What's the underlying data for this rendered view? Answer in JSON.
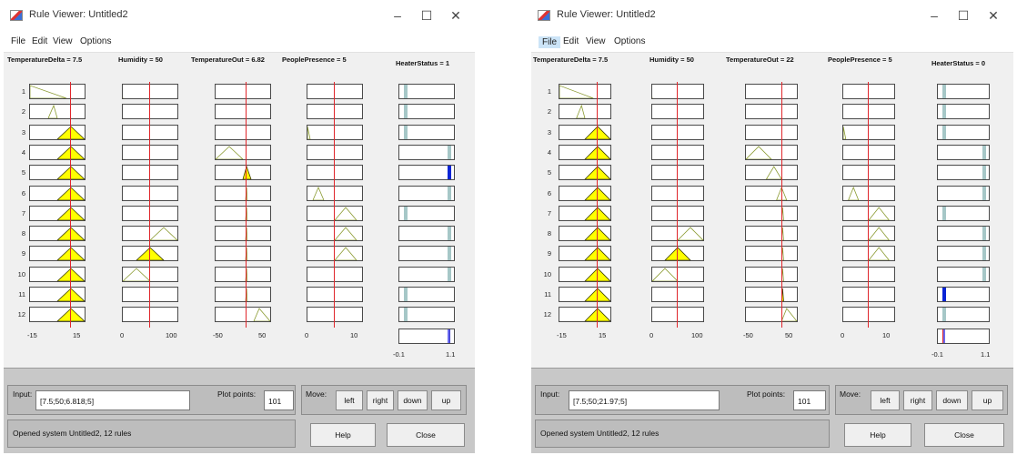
{
  "windows": [
    {
      "id": "w1",
      "title": "Rule Viewer: Untitled2",
      "controls": {
        "minimize": "–",
        "maximize": "☐",
        "close": "✕"
      },
      "menu": [
        "File",
        "Edit",
        "View",
        "Options"
      ],
      "active_menu": -1,
      "inputs": [
        {
          "header": "TemperatureDelta = 7.5",
          "range": [
            -15,
            15
          ],
          "value": 7.5,
          "ticks": [
            "-15",
            "15"
          ]
        },
        {
          "header": "Humidity = 50",
          "range": [
            0,
            100
          ],
          "value": 50,
          "ticks": [
            "0",
            "100"
          ]
        },
        {
          "header": "TemperatureOut = 6.82",
          "range": [
            -50,
            50
          ],
          "value": 6.82,
          "ticks": [
            "-50",
            "50"
          ]
        },
        {
          "header": "PeoplePresence = 5",
          "range": [
            0,
            10
          ],
          "value": 5,
          "ticks": [
            "0",
            "10"
          ]
        }
      ],
      "output": {
        "header": "HeaterStatus = 1",
        "range": [
          -0.1,
          1.1
        ],
        "value": 1,
        "ticks": [
          "-0.1",
          "1.1"
        ]
      },
      "rule_numbers": [
        "1",
        "2",
        "3",
        "4",
        "5",
        "6",
        "7",
        "8",
        "9",
        "10",
        "11",
        "12"
      ],
      "rules": [
        {
          "mf": [
            [
              -15,
              -15,
              5
            ],
            [
              -5,
              -5,
              0
            ],
            null,
            null
          ],
          "fire": [
            0,
            0,
            0,
            0
          ],
          "out": [
            0.0,
            0.04,
            0.0
          ]
        },
        {
          "mf": [
            [
              -5,
              -2,
              0
            ],
            null,
            null,
            null
          ],
          "fire": [
            0,
            0,
            0,
            0
          ],
          "out": [
            0.0,
            0.04,
            0.0
          ]
        },
        {
          "mf": [
            [
              0,
              7.5,
              15
            ],
            null,
            null,
            [
              0,
              0,
              0.5
            ]
          ],
          "fire": [
            1,
            0,
            0,
            0
          ],
          "out": [
            0.0,
            0.04,
            0.0
          ]
        },
        {
          "mf": [
            [
              0,
              7.5,
              15
            ],
            null,
            [
              -50,
              -25,
              0
            ],
            null
          ],
          "fire": [
            1,
            0,
            0,
            0
          ],
          "out": [
            0.96,
            1.0,
            0.0
          ]
        },
        {
          "mf": [
            [
              0,
              7.5,
              15
            ],
            null,
            [
              0,
              6.8,
              15
            ],
            null
          ],
          "fire": [
            1,
            0,
            1,
            0
          ],
          "out": [
            0.96,
            1.0,
            1.0
          ]
        },
        {
          "mf": [
            [
              0,
              7.5,
              15
            ],
            null,
            [
              5,
              6.8,
              8
            ],
            [
              1,
              2,
              3
            ]
          ],
          "fire": [
            1,
            0,
            0,
            0
          ],
          "out": [
            0.96,
            1.0,
            0.0
          ]
        },
        {
          "mf": [
            [
              0,
              7.5,
              15
            ],
            null,
            [
              5,
              6.8,
              8
            ],
            [
              5,
              7,
              9
            ]
          ],
          "fire": [
            1,
            0,
            0,
            0
          ],
          "out": [
            0.0,
            0.04,
            0.0
          ]
        },
        {
          "mf": [
            [
              0,
              7.5,
              15
            ],
            [
              50,
              75,
              100
            ],
            [
              5,
              6.8,
              8
            ],
            [
              5,
              7,
              9
            ]
          ],
          "fire": [
            1,
            0,
            0,
            0
          ],
          "out": [
            0.96,
            1.0,
            0.0
          ]
        },
        {
          "mf": [
            [
              0,
              7.5,
              15
            ],
            [
              25,
              50,
              75
            ],
            [
              5,
              6.8,
              8
            ],
            [
              5,
              7,
              9
            ]
          ],
          "fire": [
            1,
            1,
            0,
            0
          ],
          "out": [
            0.96,
            1.0,
            0.0
          ]
        },
        {
          "mf": [
            [
              0,
              7.5,
              15
            ],
            [
              0,
              25,
              50
            ],
            [
              5,
              6.8,
              8
            ],
            null
          ],
          "fire": [
            1,
            0,
            0,
            0
          ],
          "out": [
            0.96,
            1.0,
            0.0
          ]
        },
        {
          "mf": [
            [
              0,
              7.5,
              15
            ],
            null,
            [
              5,
              6.8,
              8
            ],
            null
          ],
          "fire": [
            1,
            0,
            0,
            0
          ],
          "out": [
            0.0,
            0.04,
            0.0
          ]
        },
        {
          "mf": [
            [
              0,
              7.5,
              15
            ],
            null,
            [
              20,
              30,
              50
            ],
            null
          ],
          "fire": [
            1,
            0,
            0,
            0
          ],
          "out": [
            0.0,
            0.04,
            0.0
          ]
        }
      ],
      "aggregate_bar": [
        0.96,
        1.0
      ],
      "bottom": {
        "input_label": "Input:",
        "input_value": "[7.5;50;6.818;5]",
        "plot_points_label": "Plot points:",
        "plot_points_value": "101",
        "move_label": "Move:",
        "move_buttons": [
          "left",
          "right",
          "down",
          "up"
        ],
        "status": "Opened system Untitled2, 12 rules",
        "help": "Help",
        "close": "Close"
      },
      "colors": {
        "mf_fill": "#ffff00",
        "mf_line": "#b5b500",
        "mf_idle": "#8a9a30",
        "output_idle": "#a6c7c7",
        "output_fired": "#0b25d6",
        "input_line": "#e0262b"
      }
    },
    {
      "id": "w2",
      "title": "Rule Viewer: Untitled2",
      "controls": {
        "minimize": "–",
        "maximize": "☐",
        "close": "✕"
      },
      "menu": [
        "File",
        "Edit",
        "View",
        "Options"
      ],
      "active_menu": 0,
      "inputs": [
        {
          "header": "TemperatureDelta = 7.5",
          "range": [
            -15,
            15
          ],
          "value": 7.5,
          "ticks": [
            "-15",
            "15"
          ]
        },
        {
          "header": "Humidity = 50",
          "range": [
            0,
            100
          ],
          "value": 50,
          "ticks": [
            "0",
            "100"
          ]
        },
        {
          "header": "TemperatureOut = 22",
          "range": [
            -50,
            50
          ],
          "value": 22,
          "ticks": [
            "-50",
            "50"
          ]
        },
        {
          "header": "PeoplePresence = 5",
          "range": [
            0,
            10
          ],
          "value": 5,
          "ticks": [
            "0",
            "10"
          ]
        }
      ],
      "output": {
        "header": "HeaterStatus = 0",
        "range": [
          -0.1,
          1.1
        ],
        "value": 0,
        "ticks": [
          "-0.1",
          "1.1"
        ]
      },
      "rule_numbers": [
        "1",
        "2",
        "3",
        "4",
        "5",
        "6",
        "7",
        "8",
        "9",
        "10",
        "11",
        "12"
      ],
      "rules": [
        {
          "mf": [
            [
              -15,
              -15,
              5
            ],
            [
              -5,
              -5,
              0
            ],
            null,
            null
          ],
          "fire": [
            0,
            0,
            0,
            0
          ],
          "out": [
            0.0,
            0.04,
            0.0
          ]
        },
        {
          "mf": [
            [
              -5,
              -2,
              0
            ],
            null,
            null,
            null
          ],
          "fire": [
            0,
            0,
            0,
            0
          ],
          "out": [
            0.0,
            0.04,
            0.0
          ]
        },
        {
          "mf": [
            [
              0,
              7.5,
              15
            ],
            null,
            null,
            [
              0,
              0,
              0.5
            ]
          ],
          "fire": [
            1,
            0,
            0,
            0
          ],
          "out": [
            0.0,
            0.04,
            0.0
          ]
        },
        {
          "mf": [
            [
              0,
              7.5,
              15
            ],
            null,
            [
              -50,
              -25,
              0
            ],
            null
          ],
          "fire": [
            1,
            0,
            0,
            0
          ],
          "out": [
            0.96,
            1.0,
            0.0
          ]
        },
        {
          "mf": [
            [
              0,
              7.5,
              15
            ],
            null,
            [
              -10,
              5,
              20
            ],
            null
          ],
          "fire": [
            1,
            0,
            0,
            0
          ],
          "out": [
            0.96,
            1.0,
            0.0
          ]
        },
        {
          "mf": [
            [
              0,
              7.5,
              15
            ],
            null,
            [
              10,
              20,
              30
            ],
            [
              1,
              2,
              3
            ]
          ],
          "fire": [
            1,
            0,
            0,
            0
          ],
          "out": [
            0.96,
            1.0,
            0.0
          ]
        },
        {
          "mf": [
            [
              0,
              7.5,
              15
            ],
            null,
            [
              20,
              22,
              24
            ],
            [
              5,
              7,
              9
            ]
          ],
          "fire": [
            1,
            0,
            0,
            0
          ],
          "out": [
            0.0,
            0.04,
            0.0
          ]
        },
        {
          "mf": [
            [
              0,
              7.5,
              15
            ],
            [
              50,
              75,
              100
            ],
            [
              20,
              22,
              24
            ],
            [
              5,
              7,
              9
            ]
          ],
          "fire": [
            1,
            0,
            0,
            0
          ],
          "out": [
            0.96,
            1.0,
            0.0
          ]
        },
        {
          "mf": [
            [
              0,
              7.5,
              15
            ],
            [
              25,
              50,
              75
            ],
            [
              20,
              22,
              24
            ],
            [
              5,
              7,
              9
            ]
          ],
          "fire": [
            1,
            1,
            0,
            0
          ],
          "out": [
            0.96,
            1.0,
            0.0
          ]
        },
        {
          "mf": [
            [
              0,
              7.5,
              15
            ],
            [
              0,
              25,
              50
            ],
            [
              20,
              22,
              24
            ],
            null
          ],
          "fire": [
            1,
            0,
            0,
            0
          ],
          "out": [
            0.96,
            1.0,
            0.0
          ]
        },
        {
          "mf": [
            [
              0,
              7.5,
              15
            ],
            null,
            [
              20,
              22,
              24
            ],
            null
          ],
          "fire": [
            1,
            0,
            1,
            0
          ],
          "out": [
            0.0,
            0.04,
            1.0
          ]
        },
        {
          "mf": [
            [
              0,
              7.5,
              15
            ],
            null,
            [
              20,
              30,
              50
            ],
            null
          ],
          "fire": [
            1,
            0,
            0,
            0
          ],
          "out": [
            0.0,
            0.04,
            0.0
          ]
        }
      ],
      "aggregate_bar": [
        0.0,
        0.04
      ],
      "bottom": {
        "input_label": "Input:",
        "input_value": "[7.5;50;21.97;5]",
        "plot_points_label": "Plot points:",
        "plot_points_value": "101",
        "move_label": "Move:",
        "move_buttons": [
          "left",
          "right",
          "down",
          "up"
        ],
        "status": "Opened system Untitled2, 12 rules",
        "help": "Help",
        "close": "Close"
      },
      "colors": {
        "mf_fill": "#ffff00",
        "mf_line": "#b5b500",
        "mf_idle": "#8a9a30",
        "output_idle": "#a6c7c7",
        "output_fired": "#0b25d6",
        "input_line": "#e0262b"
      }
    }
  ]
}
